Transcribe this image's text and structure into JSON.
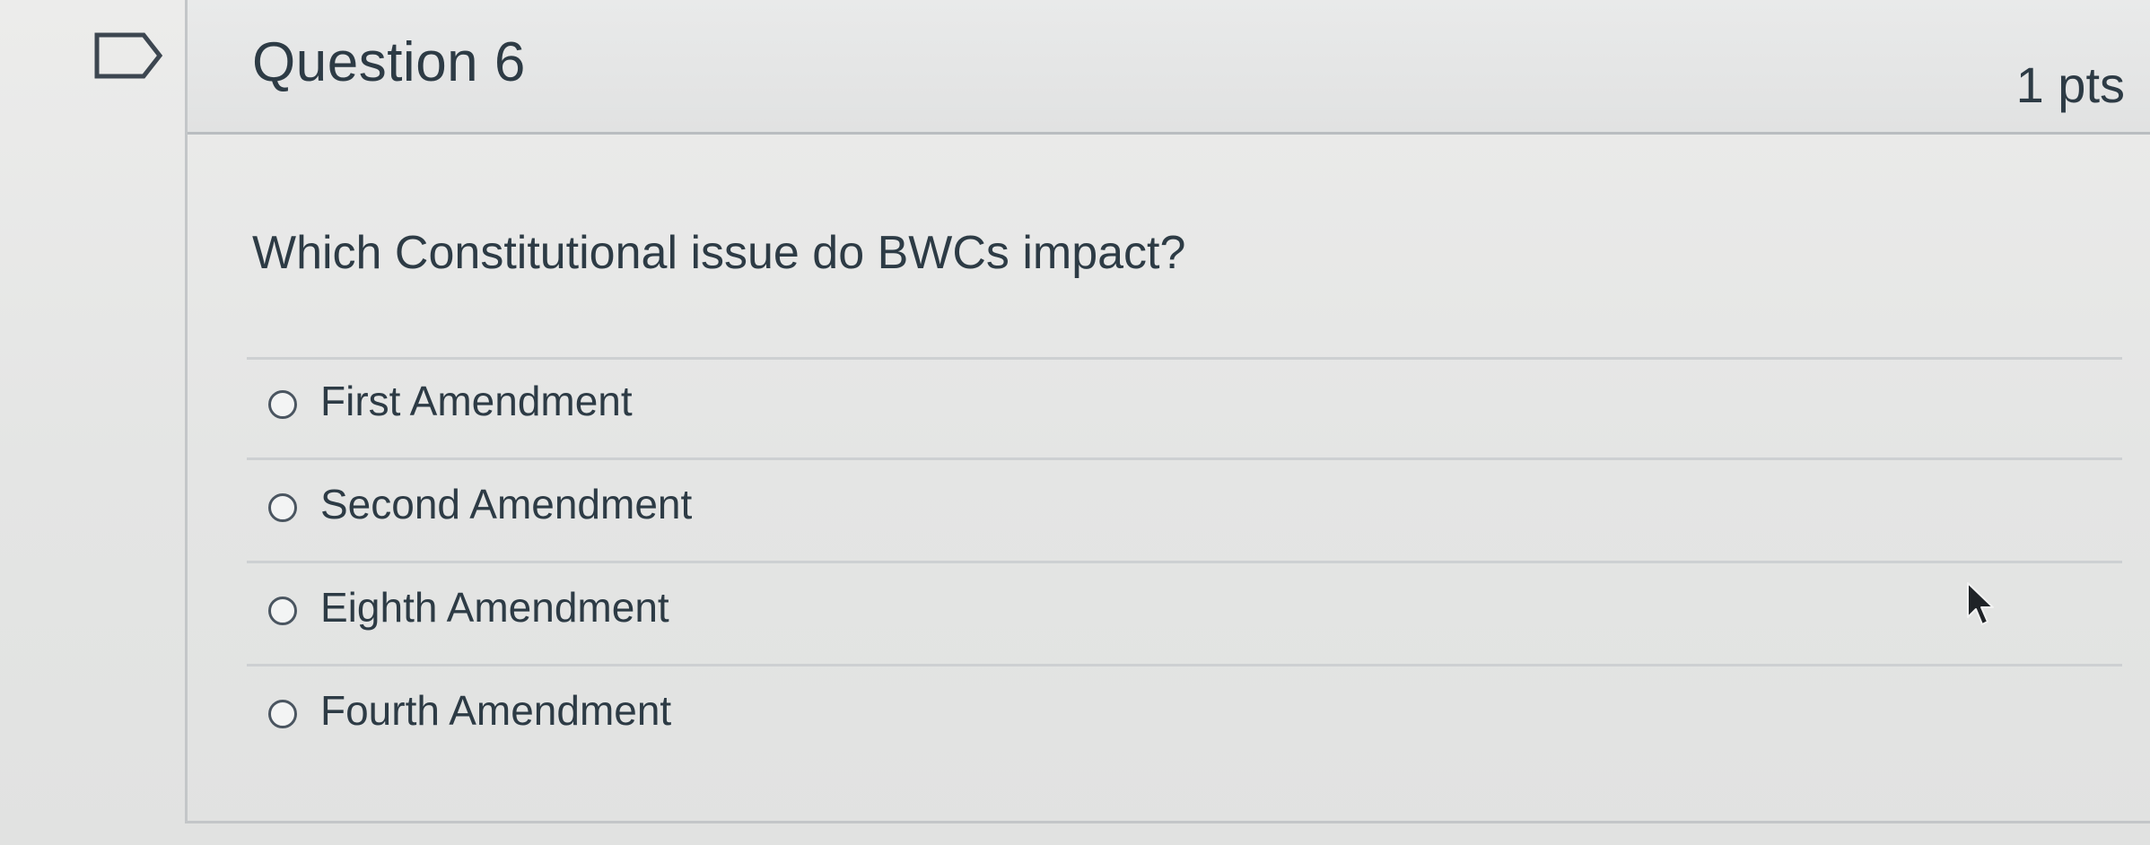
{
  "question": {
    "title": "Question 6",
    "points": "1 pts",
    "text": "Which Constitutional issue do BWCs impact?",
    "flag_icon": "flag-outline-icon"
  },
  "answers": [
    {
      "label": "First Amendment",
      "selected": false
    },
    {
      "label": "Second Amendment",
      "selected": false
    },
    {
      "label": "Eighth Amendment",
      "selected": false
    },
    {
      "label": "Fourth Amendment",
      "selected": false
    }
  ],
  "cursor_icon": "mouse-pointer-icon"
}
